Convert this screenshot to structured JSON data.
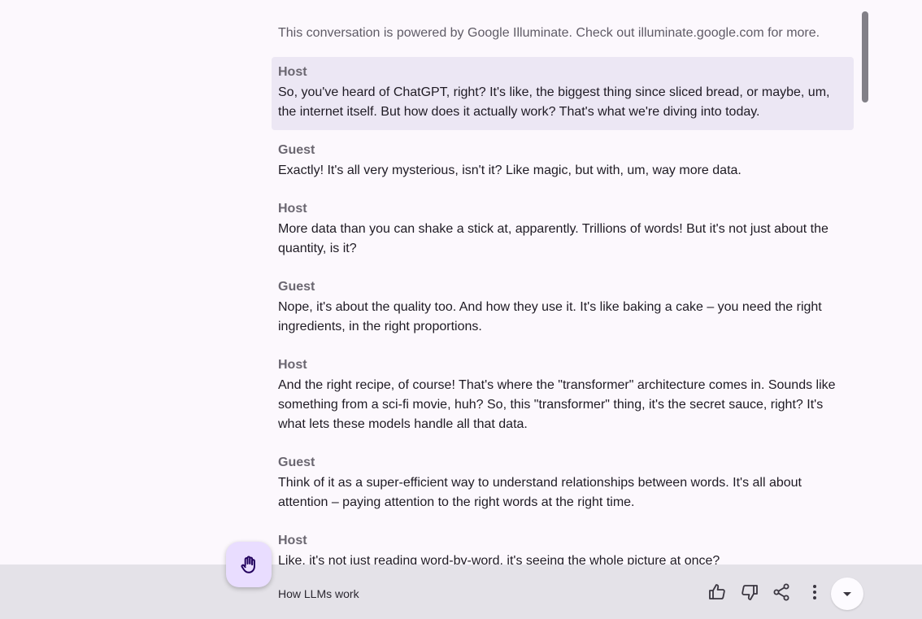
{
  "intro": "This conversation is powered by Google Illuminate. Check out illuminate.google.com for more.",
  "turns": [
    {
      "speaker": "Host",
      "text": "So, you've heard of ChatGPT, right? It's like, the biggest thing since sliced bread, or maybe, um, the internet itself. But how does it actually work? That's what we're diving into today.",
      "active": true
    },
    {
      "speaker": "Guest",
      "text": "Exactly! It's all very mysterious, isn't it? Like magic, but with, um, way more data."
    },
    {
      "speaker": "Host",
      "text": "More data than you can shake a stick at, apparently. Trillions of words! But it's not just about the quantity, is it?"
    },
    {
      "speaker": "Guest",
      "text": "Nope, it's about the quality too. And how they use it. It's like baking a cake – you need the right ingredients, in the right proportions."
    },
    {
      "speaker": "Host",
      "text": "And the right recipe, of course! That's where the \"transformer\" architecture comes in. Sounds like something from a sci-fi movie, huh? So, this \"transformer\" thing, it's the secret sauce, right? It's what lets these models handle all that data."
    },
    {
      "speaker": "Guest",
      "text": "Think of it as a super-efficient way to understand relationships between words. It's all about attention – paying attention to the right words at the right time."
    },
    {
      "speaker": "Host",
      "text": "Like, it's not just reading word-by-word, it's seeing the whole picture at once?"
    }
  ],
  "bottom_bar": {
    "title": "How LLMs work",
    "icons": [
      "thumb-up-icon",
      "thumb-down-icon",
      "share-icon",
      "more-vert-icon",
      "chevron-down-icon"
    ]
  },
  "fab": {
    "icon": "raise-hand-icon"
  },
  "colors": {
    "background": "#fcf8fd",
    "active_turn": "#ece7f4",
    "bottom_bar": "#e4e2e8",
    "fab": "#e9ddff",
    "fab_icon": "#21005d"
  }
}
